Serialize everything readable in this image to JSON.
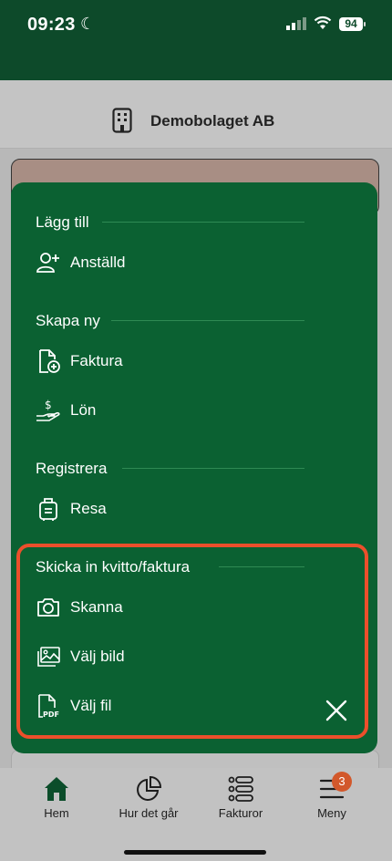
{
  "status": {
    "time": "09:23",
    "battery": "94"
  },
  "header": {
    "company": "Demobolaget AB"
  },
  "sheet": {
    "sections": [
      {
        "title": "Lägg till",
        "items": [
          {
            "label": "Anställd",
            "icon": "add-user-icon"
          }
        ]
      },
      {
        "title": "Skapa ny",
        "items": [
          {
            "label": "Faktura",
            "icon": "invoice-add-icon"
          },
          {
            "label": "Lön",
            "icon": "salary-hand-icon"
          }
        ]
      },
      {
        "title": "Registrera",
        "items": [
          {
            "label": "Resa",
            "icon": "luggage-icon"
          }
        ]
      },
      {
        "title": "Skicka in kvitto/faktura",
        "items": [
          {
            "label": "Skanna",
            "icon": "camera-icon"
          },
          {
            "label": "Välj bild",
            "icon": "image-icon"
          },
          {
            "label": "Välj fil",
            "icon": "pdf-file-icon"
          }
        ]
      }
    ],
    "pdf_icon_text": "PDF"
  },
  "tabbar": {
    "tabs": [
      {
        "label": "Hem",
        "icon": "home-icon"
      },
      {
        "label": "Hur det går",
        "icon": "pie-chart-icon"
      },
      {
        "label": "Fakturor",
        "icon": "list-icon"
      },
      {
        "label": "Meny",
        "icon": "menu-icon"
      }
    ],
    "menu_badge": "3"
  },
  "colors": {
    "sheet_green": "#0b6132",
    "highlight": "#ec4f2b",
    "status_green": "#0d4a2a"
  }
}
